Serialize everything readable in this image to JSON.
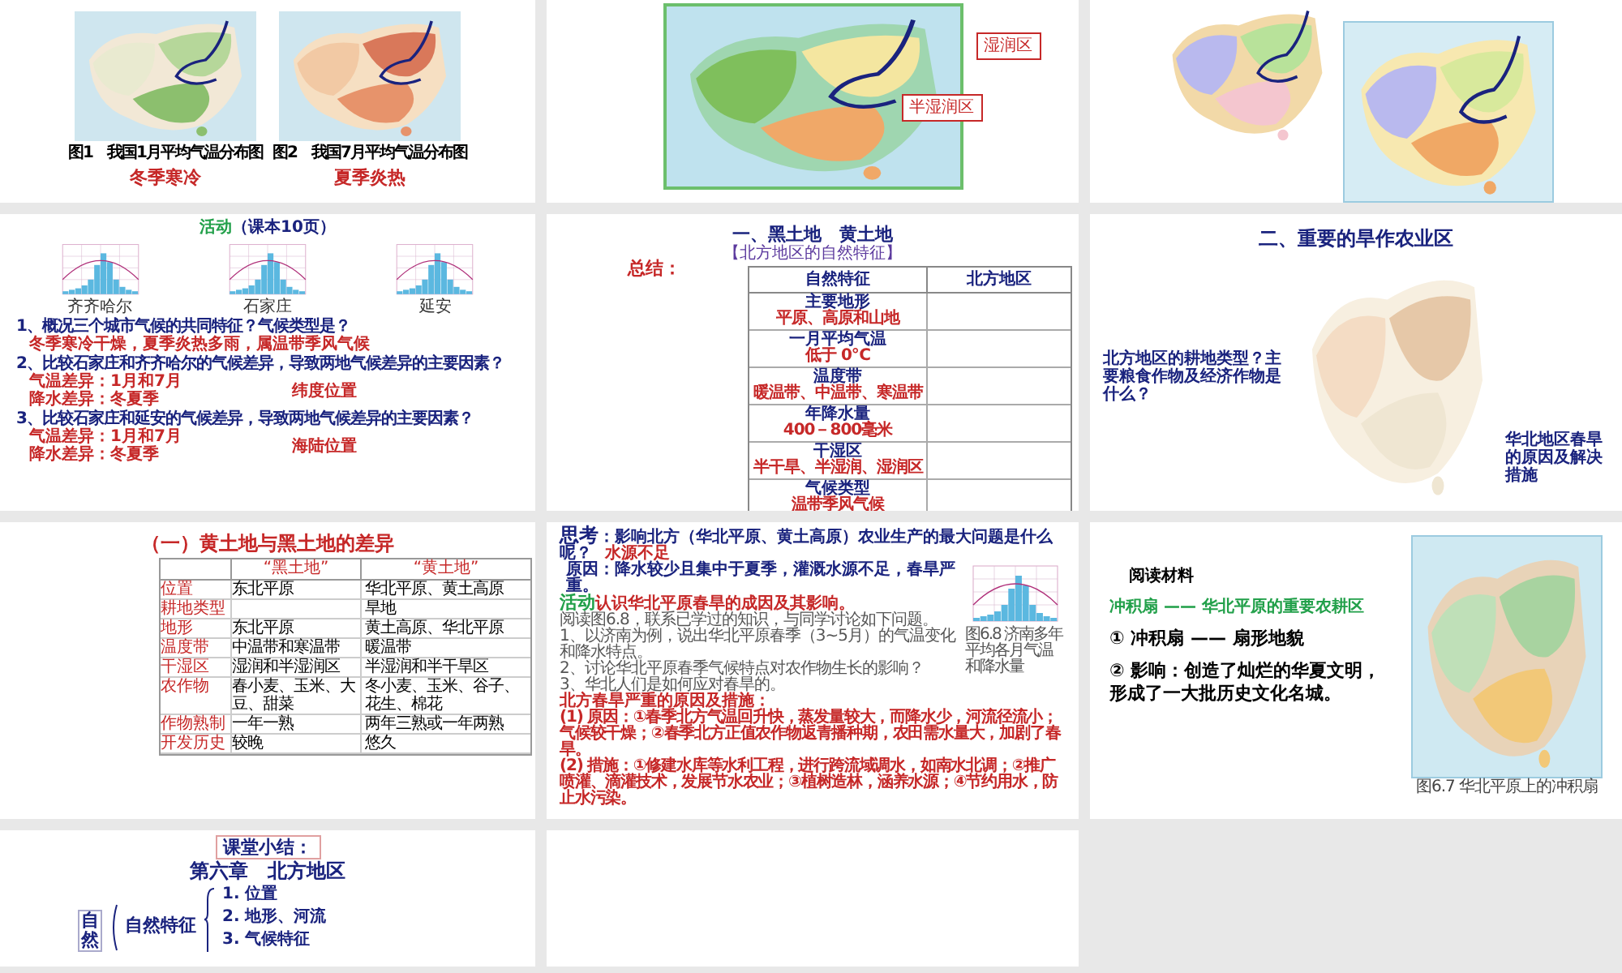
{
  "slides": [
    {
      "kind": "temperature_maps",
      "captions": [
        "图1　我国1月平均气温分布图",
        "图2　我国7月平均气温分布图"
      ],
      "notes": [
        "冬季寒冷",
        "夏季炎热"
      ]
    },
    {
      "kind": "humidity_map",
      "callouts": [
        "湿润区",
        "半湿润区"
      ]
    },
    {
      "kind": "climate_maps"
    },
    {
      "kind": "activity",
      "tag": "活动",
      "title": "（课本10页）",
      "cities": [
        "齐齐哈尔",
        "石家庄",
        "延安"
      ],
      "items": [
        {
          "question": "1、概况三个城市气候的共同特征？气候类型是？",
          "answers": [
            "冬季寒冷干燥，夏季炎热多雨，属温带季风气候"
          ]
        },
        {
          "question": "2、比较石家庄和齐齐哈尔的气候差异，导致两地气候差异的主要因素？",
          "answers": [
            "气温差异：1月和7月",
            "降水差异：冬夏季"
          ],
          "factor": "纬度位置"
        },
        {
          "question": "3、比较石家庄和延安的气候差异，导致两地气候差异的主要因素？",
          "answers": [
            "气温差异：1月和7月",
            "降水差异：冬夏季"
          ],
          "factor": "海陆位置"
        }
      ]
    },
    {
      "kind": "summary_table",
      "title": "一、黑土地　黄土地",
      "subtitle": "【北方地区的自然特征】",
      "label": "总结：",
      "columns": [
        "自然特征",
        "北方地区"
      ],
      "rows": [
        {
          "feature": "主要地形",
          "answer": "平原、高原和山地"
        },
        {
          "feature": "一月平均气温",
          "answer": "低于 0℃"
        },
        {
          "feature": "温度带",
          "answer": "暖温带、中温带、寒温带"
        },
        {
          "feature": "年降水量",
          "answer": "400－800毫米"
        },
        {
          "feature": "干湿区",
          "answer": "半干旱、半湿润、湿润区"
        },
        {
          "feature": "气候类型",
          "answer": "温带季风气候"
        }
      ]
    },
    {
      "kind": "crop_region",
      "title": "二、重要的旱作农业区",
      "question": "北方地区的耕地类型？主要粮食作物及经济作物是什么？",
      "note": "华北地区春旱的原因及解决措施"
    },
    {
      "kind": "difference_table",
      "title": "（一）黄土地与黑土地的差异",
      "columns": [
        "“黑土地”",
        "“黄土地”"
      ],
      "rows": [
        {
          "aspect": "位置",
          "black": "东北平原",
          "yellow": "华北平原、黄土高原"
        },
        {
          "aspect": "耕地类型",
          "yellow": "旱地"
        },
        {
          "aspect": "地形",
          "black": "东北平原",
          "yellow": "黄土高原、华北平原"
        },
        {
          "aspect": "温度带",
          "black": "中温带和寒温带",
          "yellow": "暖温带"
        },
        {
          "aspect": "干湿区",
          "black": "湿润和半湿润区",
          "yellow": "半湿润和半干旱区"
        },
        {
          "aspect": "农作物",
          "black": "春小麦、玉米、大豆、甜菜",
          "yellow": "冬小麦、玉米、谷子、花生、棉花"
        },
        {
          "aspect": "作物熟制",
          "black": "一年一熟",
          "yellow": "两年三熟或一年两熟"
        },
        {
          "aspect": "开发历史",
          "black": "较晚",
          "yellow": "悠久"
        }
      ]
    },
    {
      "kind": "thinking",
      "tag": "思考",
      "question": "：影响北方（华北平原、黄土高原）农业生产的最大问题是什么呢？",
      "answer": "水源不足",
      "reason": "原因：降水较少且集中于夏季，灌溉水源不足，春旱严重。",
      "activity_tag": "活动",
      "activity": "认识华北平原春旱的成因及其影响。",
      "lines": [
        "阅读图6.8，联系已学过的知识，与同学讨论如下问题。",
        "1、以济南为例，说出华北平原春季（3~5月）的气温变化和降水特点。",
        "2、讨论华北平原春季气候特点对农作物生长的影响？",
        "3、华北人们是如何应对春旱的。"
      ],
      "chart_caption": "图6.8 济南多年平均各月气温和降水量",
      "conclusion_title": "北方春旱严重的原因及措施：",
      "conclusions": [
        "(1) 原因：①春季北方气温回升快，蒸发量较大，而降水少，河流径流小；气候较干燥；②春季北方正值农作物返青播种期，农田需水量大，加剧了春旱。",
        "(2) 措施：①修建水库等水利工程，进行跨流域调水，如南水北调；②推广喷灌、滴灌技术，发展节水农业；③植树造林，涵养水源；④节约用水，防止水污染。"
      ]
    },
    {
      "kind": "reading",
      "title": "阅读材料",
      "subtitle": "冲积扇 —— 华北平原的重要农耕区",
      "points": [
        "① 冲积扇 —— 扇形地貌",
        "② 影响：创造了灿烂的华夏文明，形成了一大批历史文化名城。"
      ],
      "caption": "图6.7 华北平原上的冲积扇"
    },
    {
      "kind": "chapter_summary",
      "label": "课堂小结：",
      "title": "第六章　北方地区",
      "side": "自然",
      "group": "自然特征",
      "items": [
        "1. 位置",
        "2. 地形、河流",
        "3. 气候特征"
      ]
    },
    {
      "kind": "blank"
    }
  ]
}
